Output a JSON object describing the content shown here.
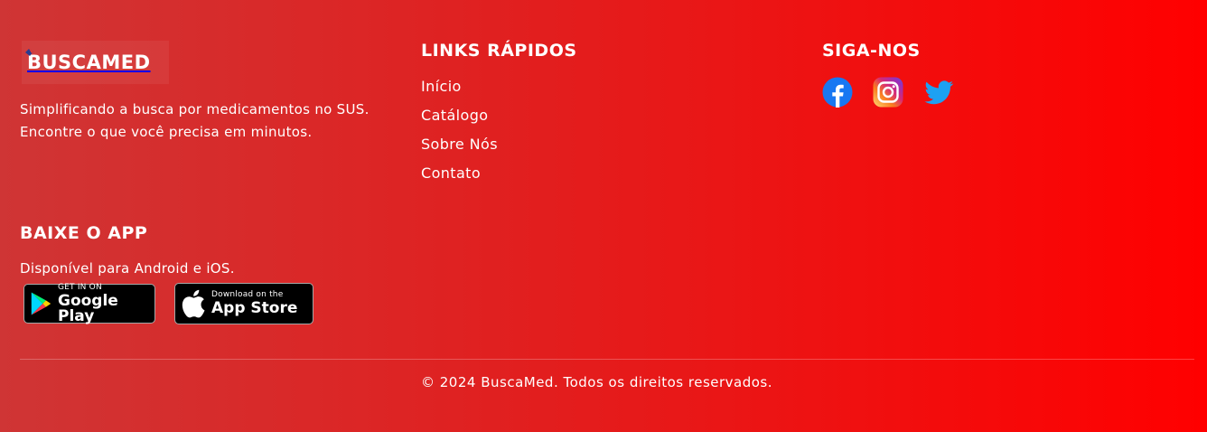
{
  "brand": {
    "logo_text": "BUSCAMED",
    "tagline": "Simplificando a busca por medicamentos no SUS. Encontre o que você precisa em minutos."
  },
  "links": {
    "title": "LINKS RÁPIDOS",
    "items": [
      "Início",
      "Catálogo",
      "Sobre Nós",
      "Contato"
    ]
  },
  "social": {
    "title": "SIGA-NOS",
    "icons": [
      "facebook-icon",
      "instagram-icon",
      "twitter-icon"
    ]
  },
  "app": {
    "title": "BAIXE O APP",
    "subtitle": "Disponível para Android e iOS.",
    "google_play": {
      "small": "GET IN ON",
      "big": "Google Play"
    },
    "app_store": {
      "small": "Download on the",
      "big": "App Store"
    }
  },
  "footer": {
    "copyright": "© 2024 BuscaMed. Todos os direitos reservados."
  },
  "colors": {
    "gradient_start": "#cf3535",
    "gradient_end": "#ff0000",
    "facebook": "#1877f2",
    "twitter": "#1da1f2"
  }
}
